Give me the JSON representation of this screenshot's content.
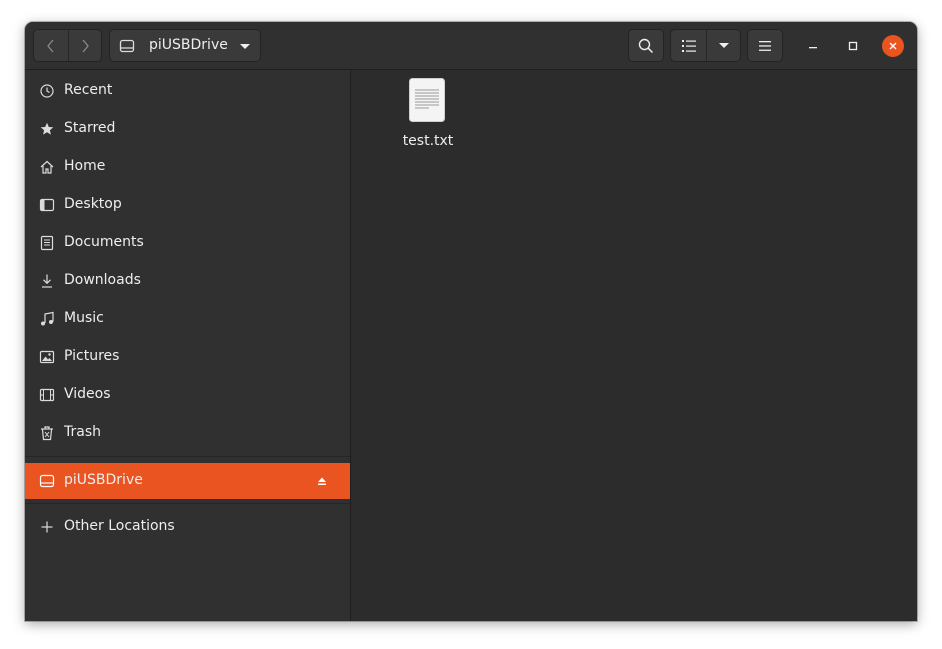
{
  "headerbar": {
    "location_label": "piUSBDrive",
    "icons": {
      "back": "chevron-left-icon",
      "forward": "chevron-right-icon",
      "drive": "drive-icon",
      "path_menu": "dropdown-arrow-icon",
      "search": "search-icon",
      "view_list": "list-view-icon",
      "view_options": "dropdown-arrow-icon",
      "menu": "hamburger-icon",
      "minimize": "minimize-icon",
      "maximize": "maximize-icon",
      "close": "close-icon"
    }
  },
  "sidebar": {
    "items": [
      {
        "label": "Recent",
        "icon": "clock-icon"
      },
      {
        "label": "Starred",
        "icon": "star-icon"
      },
      {
        "label": "Home",
        "icon": "home-icon"
      },
      {
        "label": "Desktop",
        "icon": "desktop-icon"
      },
      {
        "label": "Documents",
        "icon": "document-icon"
      },
      {
        "label": "Downloads",
        "icon": "download-icon"
      },
      {
        "label": "Music",
        "icon": "music-icon"
      },
      {
        "label": "Pictures",
        "icon": "picture-icon"
      },
      {
        "label": "Videos",
        "icon": "video-icon"
      },
      {
        "label": "Trash",
        "icon": "trash-icon"
      }
    ],
    "devices": [
      {
        "label": "piUSBDrive",
        "icon": "drive-icon",
        "selected": true
      }
    ],
    "other": {
      "label": "Other Locations",
      "icon": "plus-icon"
    }
  },
  "content": {
    "files": [
      {
        "name": "test.txt",
        "icon": "text-file-icon"
      }
    ]
  },
  "colors": {
    "accent": "#e95420",
    "sidebar_bg": "#303030",
    "content_bg": "#2c2c2c"
  }
}
